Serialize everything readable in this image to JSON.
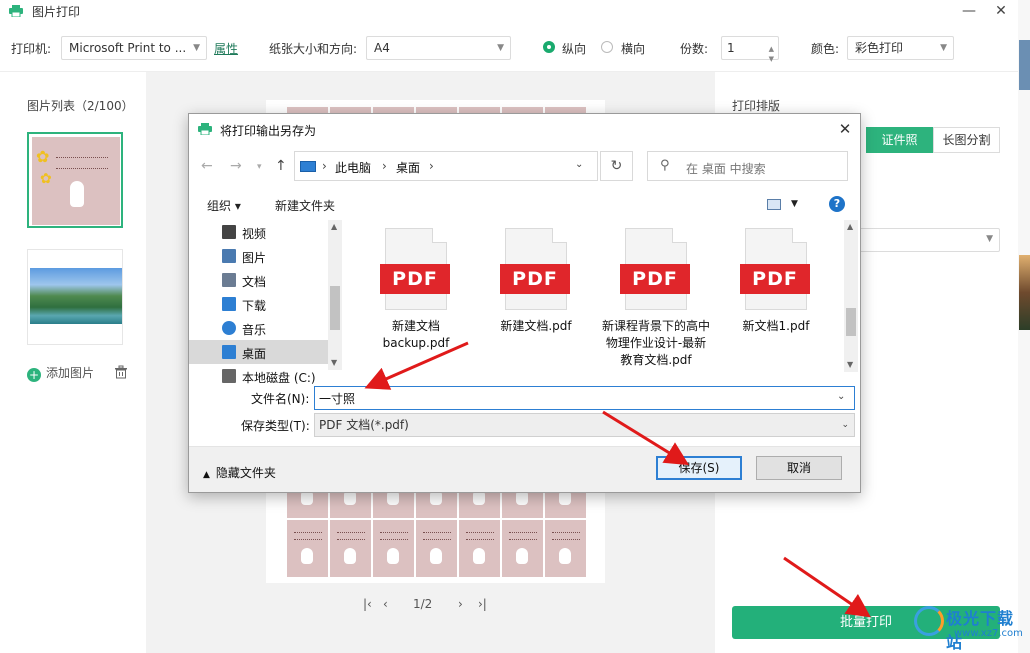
{
  "window": {
    "title": "图片打印"
  },
  "toolbar": {
    "printer_label": "打印机:",
    "printer_value": "Microsoft Print to ...",
    "properties_link": "属性",
    "paper_label": "纸张大小和方向:",
    "paper_value": "A4",
    "portrait": "纵向",
    "landscape": "横向",
    "copies_label": "份数:",
    "copies_value": "1",
    "color_label": "颜色:",
    "color_value": "彩色打印"
  },
  "left_panel": {
    "title": "图片列表（2/100）",
    "add_image": "添加图片"
  },
  "preview": {
    "page": "1/2"
  },
  "right_panel": {
    "title": "打印排版",
    "tabs": [
      "证件照",
      "长图分割"
    ],
    "batch_print": "批量打印"
  },
  "dialog": {
    "title": "将打印输出另存为",
    "breadcrumb": [
      "此电脑",
      "桌面"
    ],
    "search_placeholder": "在 桌面 中搜索",
    "organize": "组织 ▾",
    "new_folder": "新建文件夹",
    "nav_items": [
      {
        "label": "视频",
        "icon": "video-icon"
      },
      {
        "label": "图片",
        "icon": "picture-icon"
      },
      {
        "label": "文档",
        "icon": "document-icon"
      },
      {
        "label": "下载",
        "icon": "download-icon"
      },
      {
        "label": "音乐",
        "icon": "music-icon"
      },
      {
        "label": "桌面",
        "icon": "desktop-icon"
      },
      {
        "label": "本地磁盘 (C:)",
        "icon": "disk-icon"
      }
    ],
    "files": [
      {
        "name": "新建文档backup.pdf",
        "badge": "PDF"
      },
      {
        "name": "新建文档.pdf",
        "badge": "PDF"
      },
      {
        "name": "新课程背景下的高中物理作业设计-最新教育文档.pdf",
        "badge": "PDF"
      },
      {
        "name": "新文档1.pdf",
        "badge": "PDF"
      }
    ],
    "filename_label": "文件名(N):",
    "filename_value": "一寸照",
    "filetype_label": "保存类型(T):",
    "filetype_value": "PDF 文档(*.pdf)",
    "hide_folders": "隐藏文件夹",
    "save": "保存(S)",
    "cancel": "取消"
  },
  "watermark": {
    "text": "极光下载站",
    "url": "www.xz7.com"
  },
  "colors": {
    "accent": "#23b07a",
    "arrow": "#e01a1a",
    "dialog_focus": "#2d7fd3"
  }
}
